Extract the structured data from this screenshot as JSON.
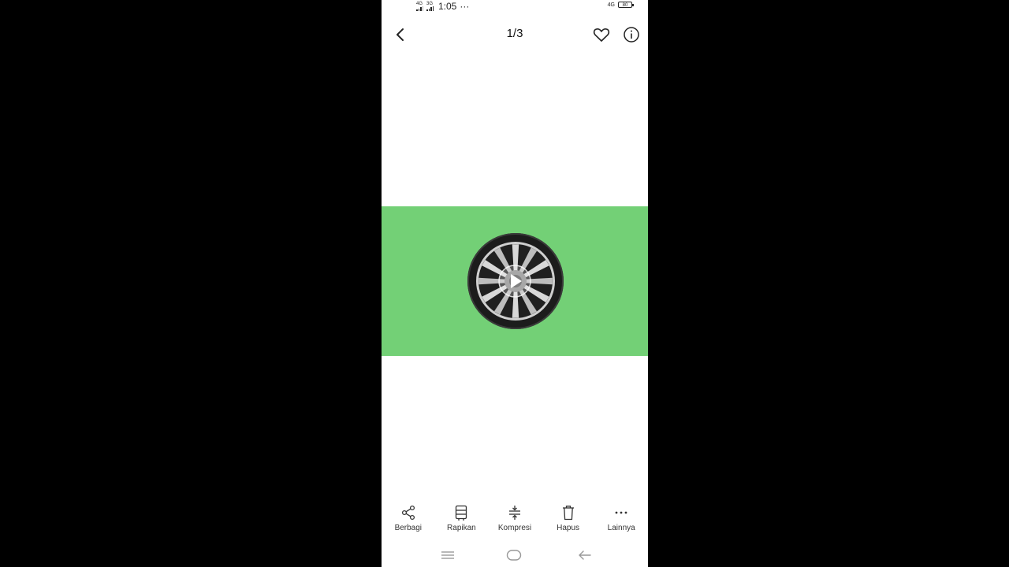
{
  "status_bar": {
    "network_1": "4G",
    "network_2": "3G",
    "time": "1:05",
    "more": "···",
    "network_right": "4G",
    "battery": "80"
  },
  "header": {
    "counter": "1/3",
    "back_icon": "chevron-left-icon",
    "favorite_icon": "heart-icon",
    "info_icon": "info-icon"
  },
  "media": {
    "background_color": "#73d076",
    "content": "wheel-image",
    "play_icon": "play-icon"
  },
  "toolbar": {
    "items": [
      {
        "label": "Berbagi",
        "icon": "share-icon"
      },
      {
        "label": "Rapikan",
        "icon": "tidy-icon"
      },
      {
        "label": "Kompresi",
        "icon": "compress-icon"
      },
      {
        "label": "Hapus",
        "icon": "trash-icon"
      },
      {
        "label": "Lainnya",
        "icon": "more-icon"
      }
    ]
  },
  "nav_bar": {
    "menu_icon": "menu-icon",
    "home_icon": "home-icon",
    "back_icon": "back-arrow-icon"
  }
}
